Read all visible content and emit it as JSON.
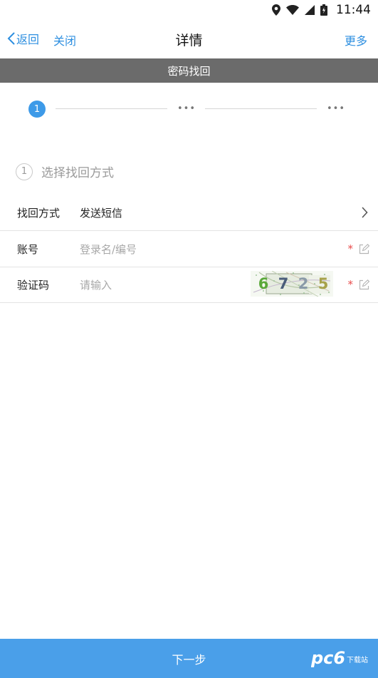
{
  "status_bar": {
    "time": "11:44"
  },
  "header": {
    "back_label": "返回",
    "close_label": "关闭",
    "title": "详情",
    "more_label": "更多"
  },
  "section_title": "密码找回",
  "stepper": {
    "current_step": "1",
    "pending_marker": "•••"
  },
  "method": {
    "number": "1",
    "title": "选择找回方式"
  },
  "form": {
    "method_row": {
      "label": "找回方式",
      "value": "发送短信"
    },
    "account_row": {
      "label": "账号",
      "placeholder": "登录名/编号",
      "required_mark": "*"
    },
    "captcha_row": {
      "label": "验证码",
      "placeholder": "请输入",
      "captcha_text": "6725",
      "required_mark": "*"
    }
  },
  "next_button": "下一步",
  "watermark": {
    "text": "pc6",
    "subtext": "下载站"
  },
  "colors": {
    "accent": "#3d9ae8",
    "section_bg": "#6b6b6b",
    "required": "#e84c4c",
    "button_bg": "#4a9fe9"
  }
}
